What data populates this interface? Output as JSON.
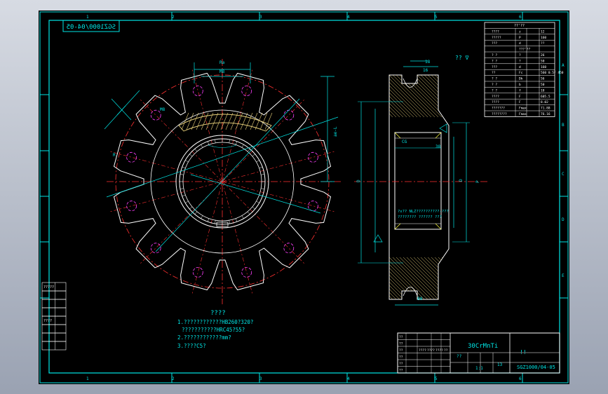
{
  "sheet": {
    "colors": {
      "frame": "#00e5e5",
      "outline": "#ffffff",
      "center": "#ff3030",
      "dim": "#00e5e5",
      "hatch": "#e8d07a",
      "magenta": "#ff40ff",
      "yellow": "#ffff40",
      "bg": "#000000"
    },
    "top_zone_labels": [
      "1",
      "2",
      "3",
      "4",
      "5",
      "6"
    ],
    "bottom_zone_labels": [
      "1",
      "2",
      "3",
      "4",
      "5",
      "6"
    ],
    "side_zone_labels": [
      "A",
      "B",
      "C",
      "D",
      "E"
    ],
    "mirrored_drawing_no": "SGZ1000/04-05"
  },
  "param_table": {
    "header": "??'??",
    "rows": [
      [
        "????",
        "z",
        "12"
      ],
      [
        "?????",
        "P",
        "160"
      ],
      [
        "???",
        "d",
        "??"
      ],
      [
        "",
        "???'??",
        ""
      ],
      [
        "? ?",
        "?",
        "26"
      ],
      [
        "? ?",
        "?",
        "50"
      ],
      [
        "???",
        "d",
        "160"
      ],
      [
        "??",
        "Fc",
        "560 0.5F 450"
      ],
      [
        "? ?",
        "Dk",
        "56"
      ],
      [
        "? ?",
        "b",
        "50"
      ],
      [
        "? ?",
        "f",
        "18"
      ],
      [
        "????",
        "F",
        "605.5"
      ],
      [
        "????",
        "F",
        "8.02"
      ],
      [
        "???????",
        "Fmax",
        "71.88"
      ],
      [
        "????????",
        "Fmax",
        "76.16"
      ]
    ]
  },
  "dims": {
    "top_slot": "Ra",
    "top_width": "M8",
    "left_angle": "R",
    "chord": "M8",
    "right_height": "ae-L",
    "bore_note": "??",
    "small_note": "R",
    "side_top_a": "18",
    "side_top_b": "16",
    "side_left": "D",
    "side_mid_a": "CG",
    "side_mid_b": "38",
    "side_right_a": "P",
    "side_right_b": "D",
    "side_bottom": "80",
    "side_note_a": "?x?? NLZ??????????-???",
    "side_note_b": "???????? ?????? ???",
    "side_tol": "??",
    "rough_mark": "?? ∇"
  },
  "tech": {
    "title": "????",
    "lines": [
      "1.????????????HB260?320?",
      "???????????HRC45?55?",
      "2.????????????mm?",
      "3.????C5?"
    ]
  },
  "left_block": {
    "labels": [
      "?????",
      "",
      "",
      "",
      "????",
      "",
      "",
      ""
    ]
  },
  "title_block": {
    "material": "30CrMnTi",
    "name": "!!",
    "drawing_no": "SGZ1000/04-05",
    "scale": "1:1",
    "weight": "??",
    "sheet": "13",
    "row_labels": [
      "??",
      "??",
      "??",
      "??",
      "??",
      "??"
    ],
    "cells": [
      "????",
      "????",
      "????",
      "??"
    ]
  }
}
